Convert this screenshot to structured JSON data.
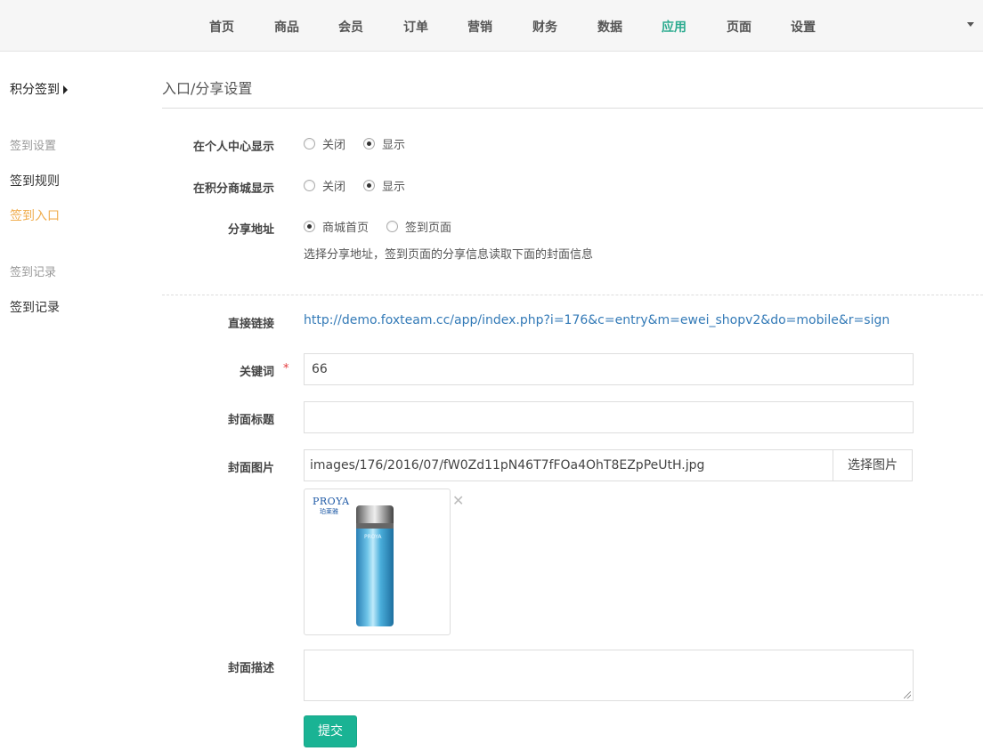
{
  "topnav": {
    "items": [
      "首页",
      "商品",
      "会员",
      "订单",
      "营销",
      "财务",
      "数据",
      "应用",
      "页面",
      "设置"
    ],
    "active_index": 7,
    "accent_color": "#2cab8f"
  },
  "sidebar": {
    "title": "积分签到",
    "groups": [
      {
        "label": "签到设置",
        "items": [
          "签到规则",
          "签到入口"
        ]
      },
      {
        "label": "签到记录",
        "items": [
          "签到记录"
        ]
      }
    ],
    "active_item": "签到入口",
    "active_color": "#f0ad4e"
  },
  "main": {
    "title": "入口/分享设置",
    "fields": {
      "member_center": {
        "label": "在个人中心显示",
        "options": [
          "关闭",
          "显示"
        ],
        "selected": "显示"
      },
      "points_mall": {
        "label": "在积分商城显示",
        "options": [
          "关闭",
          "显示"
        ],
        "selected": "显示"
      },
      "share_url": {
        "label": "分享地址",
        "options": [
          "商城首页",
          "签到页面"
        ],
        "selected": "商城首页",
        "help": "选择分享地址，签到页面的分享信息读取下面的封面信息"
      },
      "direct_link": {
        "label": "直接链接",
        "value": "http://demo.foxteam.cc/app/index.php?i=176&c=entry&m=ewei_shopv2&do=mobile&r=sign"
      },
      "keyword": {
        "label": "关键词",
        "required_mark": "*",
        "value": "66"
      },
      "cover_title": {
        "label": "封面标题",
        "value": ""
      },
      "cover_image": {
        "label": "封面图片",
        "value": "images/176/2016/07/fW0Zd11pN46T7fFOa4OhT8EZpPeUtH.jpg",
        "button": "选择图片",
        "close_glyph": "✕"
      },
      "cover_desc": {
        "label": "封面描述",
        "value": ""
      }
    },
    "submit_label": "提交",
    "submit_color": "#1ab394"
  },
  "thumbnail": {
    "brand": "PROYA",
    "brand_sub": "珀莱雅",
    "bottle_text": "PROYA"
  }
}
